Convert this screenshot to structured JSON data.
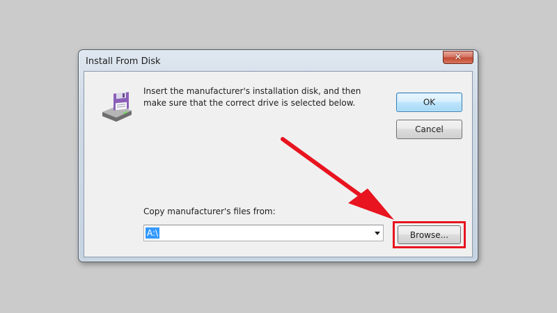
{
  "window": {
    "title": "Install From Disk",
    "close_symbol": "✕"
  },
  "dialog": {
    "icon": "floppy-disk-drive-icon",
    "message_line1": "Insert the manufacturer's installation disk, and then",
    "message_line2": "make sure that the correct drive is selected below.",
    "ok_label": "OK",
    "cancel_label": "Cancel",
    "copy_label": "Copy manufacturer's files from:",
    "copy_value": "A:\\",
    "browse_label": "Browse..."
  },
  "annotation": {
    "color": "#e8141f",
    "target": "Browse..."
  },
  "colors": {
    "background": "#cbcbcb",
    "selection": "#3399ff",
    "highlight": "#e8141f"
  }
}
